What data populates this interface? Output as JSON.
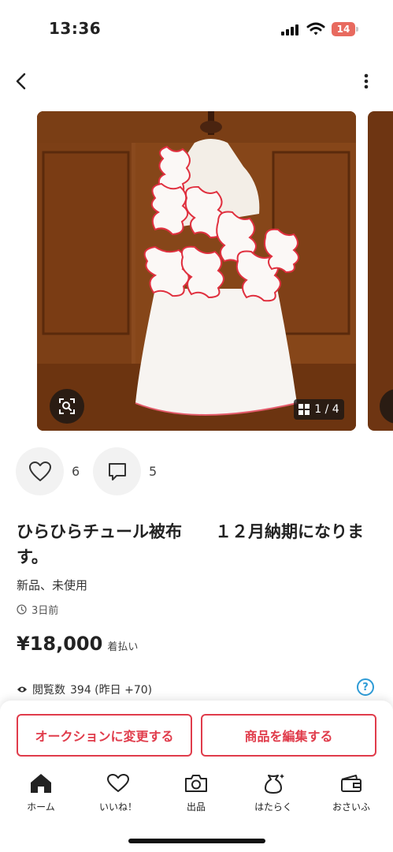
{
  "status_bar": {
    "time": "13:36",
    "battery": "14",
    "icons": [
      "signal-icon",
      "wifi-icon",
      "battery-icon"
    ]
  },
  "header": {
    "back_icon": "chevron-left-icon",
    "more_icon": "more-vertical-icon"
  },
  "gallery": {
    "counter": "1 / 4",
    "counter_icon": "grid-icon",
    "lens_icon": "image-search-icon"
  },
  "actions": {
    "likes": "6",
    "comments": "5",
    "like_icon": "heart-icon",
    "comment_icon": "comment-icon"
  },
  "item": {
    "title": "ひらひらチュール被布　　１２月納期になります。",
    "condition": "新品、未使用",
    "posted": "3日前",
    "price": "¥18,000",
    "shipping": "着払い",
    "views_label": "閲覧数",
    "views": "394 (昨日 +70)",
    "help": "?"
  },
  "bottom_actions": {
    "auction_button": "オークションに変更する",
    "edit_button": "商品を編集する"
  },
  "tabs": [
    {
      "label": "ホーム",
      "icon": "home-icon"
    },
    {
      "label": "いいね！",
      "icon": "heart-icon"
    },
    {
      "label": "出品",
      "icon": "camera-icon"
    },
    {
      "label": "はたらく",
      "icon": "work-bag-icon"
    },
    {
      "label": "おさいふ",
      "icon": "wallet-icon"
    }
  ],
  "colors": {
    "accent": "#e03c4b",
    "help": "#2e9bd6",
    "battery": "#e86a5f"
  }
}
